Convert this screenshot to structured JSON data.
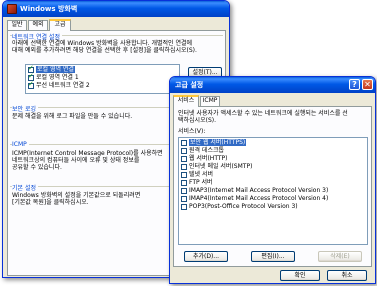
{
  "firewall_window": {
    "title": "Windows 방화벽",
    "tabs": [
      {
        "label": "일반"
      },
      {
        "label": "예외"
      },
      {
        "label": "고급"
      }
    ],
    "network": {
      "group_title": "네트워크 연결 설정",
      "desc_line1": "아래에 선택한 연결에 Windows 방화벽을 사용합니다. 개별적인 연결에",
      "desc_line2": "대해 예외를 추가하려면 해당 연결을 선택한 후 [설정]을 클릭하십시오(S).",
      "connections": [
        {
          "label": "로컬 영역 연결",
          "checked": true,
          "selected": true
        },
        {
          "label": "로컬 영역 연결 1",
          "checked": true,
          "selected": false
        },
        {
          "label": "무선 네트워크 연결 2",
          "checked": true,
          "selected": false
        }
      ],
      "settings_button": "설정(T)..."
    },
    "security_log": {
      "group_title": "보안 로깅",
      "desc": "문제 해결을 위해 로그 파일을 만들 수 있습니다."
    },
    "icmp": {
      "group_title": "ICMP",
      "desc_line1": "ICMP(Internet Control Message Protocol)를 사용하면",
      "desc_line2": "네트워크상의 컴퓨터들 사이에 오류 및 상태 정보를",
      "desc_line3": "공유할 수 있습니다."
    },
    "defaults": {
      "group_title": "기본 설정",
      "desc_line1": "Windows 방화벽의 설정을 기본값으로 되돌리려면",
      "desc_line2": "[기본값 복원]을 클릭하십시오."
    }
  },
  "advanced_dialog": {
    "title": "고급 설정",
    "help_button": "?",
    "close_button": "✕",
    "tabs": [
      {
        "label": "서비스"
      },
      {
        "label": "ICMP"
      }
    ],
    "desc_line1": "인터넷 사용자가 액세스할 수 있는 네트워크에 실행되는 서비스를 선",
    "desc_line2": "택하십시오(S).",
    "services_label": "서비스(V):",
    "services": [
      {
        "label": "보안 웹 서버(HTTPS)",
        "checked": false,
        "selected": true
      },
      {
        "label": "원격 데스크톱",
        "checked": false,
        "selected": false
      },
      {
        "label": "웹 서버(HTTP)",
        "checked": false,
        "selected": false
      },
      {
        "label": "인터넷 메일 서버(SMTP)",
        "checked": false,
        "selected": false
      },
      {
        "label": "텔넷 서버",
        "checked": false,
        "selected": false
      },
      {
        "label": "FTP 서버",
        "checked": false,
        "selected": false
      },
      {
        "label": "IMAP3(Internet Mail Access Protocol Version 3)",
        "checked": false,
        "selected": false
      },
      {
        "label": "IMAP4(Internet Mail Access Protocol Version 4)",
        "checked": false,
        "selected": false
      },
      {
        "label": "POP3(Post-Office Protocol Version 3)",
        "checked": false,
        "selected": false
      }
    ],
    "add_button": "추가(D)...",
    "edit_button": "편집(I)...",
    "delete_button": "삭제(E)",
    "ok_button": "확인",
    "cancel_button": "취소"
  },
  "colors": {
    "titlebar": "#0058e6",
    "group_title": "#0046d5",
    "selection": "#316ac5",
    "dialog_bg": "#ece9d8"
  }
}
